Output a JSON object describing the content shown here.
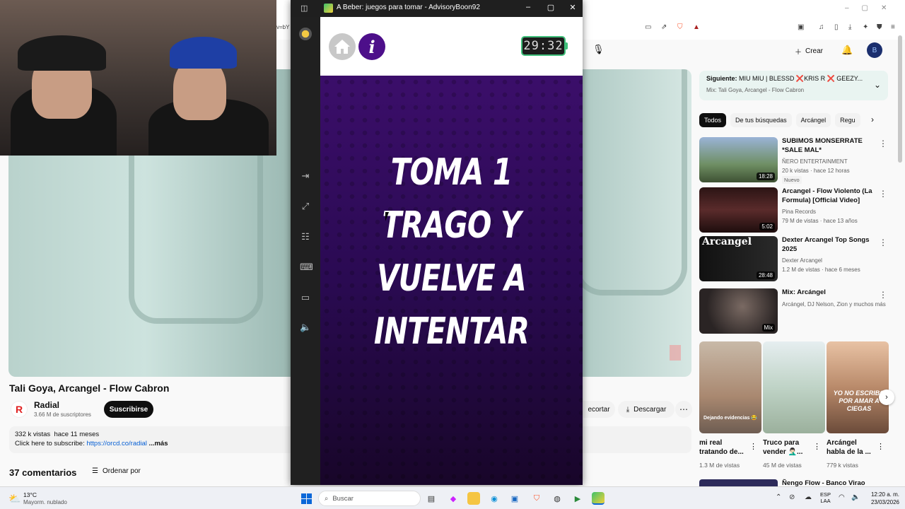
{
  "browser": {
    "url_fragment": "v=bY",
    "toolbar_icons": [
      "cast-icon",
      "share-icon",
      "brave-shield-icon",
      "rewards-icon"
    ]
  },
  "youtube": {
    "create_label": "Crear",
    "video": {
      "title": "Tali Goya, Arcangel - Flow Cabron",
      "channel_name": "Radial",
      "channel_initial": "R",
      "subscribers": "3.66 M de suscriptores",
      "subscribe_label": "Suscribirse",
      "recortar_label": "ecortar",
      "download_label": "Descargar",
      "views": "332 k vistas",
      "published": "hace 11 meses",
      "desc_prefix": "Click here to subscribe: ",
      "desc_link": "https://orcd.co/radial",
      "desc_more": " ...más",
      "comments": "37 comentarios",
      "sort_label": "Ordenar por"
    },
    "next": {
      "label": "Siguiente:",
      "title": "MIU MIU | BLESSD ❌KRIS R ❌ GEEZY...",
      "subtitle": "Mix: Tali Goya, Arcangel - Flow Cabron"
    },
    "chips": [
      "Todos",
      "De tus búsquedas",
      "Arcángel",
      "Regu"
    ],
    "recommendations": [
      {
        "title": "SUBIMOS MONSERRATE *SALE MAL*",
        "channel": "ÑERO ENTERTAINMENT",
        "stats": "20 k vistas · hace 12 horas",
        "badge": "Nuevo",
        "duration": "18:28"
      },
      {
        "title": "Arcangel - Flow Violento (La Formula) [Official Video]",
        "channel": "Pina Records",
        "stats": "79 M de vistas · hace 13 años",
        "duration": "5:02"
      },
      {
        "title": "Dexter Arcangel Top Songs 2025",
        "channel": "Dexter Arcangel",
        "stats": "1.2 M de vistas · hace 6 meses",
        "duration": "28:48",
        "thumb_text": "Arcangel"
      },
      {
        "title": "Mix: Arcángel",
        "channel": "Arcángel, DJ Nelson, Zion y muchos más",
        "duration": "Mix"
      }
    ],
    "shorts": [
      {
        "title": "mi real tratando de...",
        "views": "1.3 M de vistas",
        "overlay": "Dejando evidencias 😂"
      },
      {
        "title": "Truco para vender 🤦🏻‍♂️...",
        "views": "45 M de vistas"
      },
      {
        "title": "Arcángel habla de la ...",
        "views": "779 k vistas",
        "overlay": "YO NO ESCRIBO POR AMAR A CIEGAS"
      }
    ],
    "bottom_rec_title": "Ñengo Flow - Banco Virao"
  },
  "app": {
    "window_title": "A Beber: juegos para tomar - AdvisoryBoon92",
    "info_label": "i",
    "timer": "29:32",
    "message_lines": [
      "TOMA 1",
      "TRAGO Y",
      "VUELVE A",
      "INTENTAR"
    ],
    "accent_color": "#4d0f8a",
    "background_color": "#2a0a52"
  },
  "taskbar": {
    "temperature": "13°C",
    "weather": "Mayorm. nublado",
    "search_placeholder": "Buscar",
    "lang_top": "ESP",
    "lang_bottom": "LAA",
    "time": "12:20 a. m.",
    "date": "23/03/2026"
  }
}
